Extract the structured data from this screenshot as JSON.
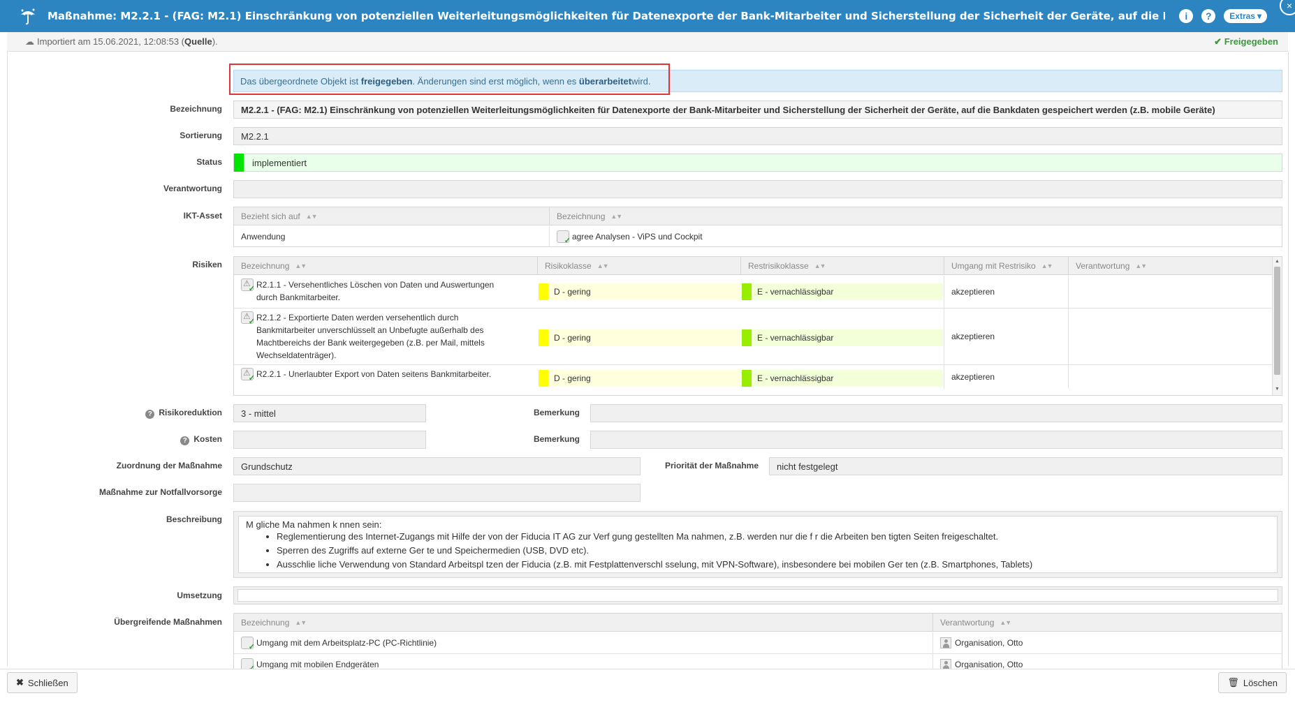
{
  "titlebar": {
    "title": "Maßnahme: M2.2.1 - (FAG: M2.1) Einschränkung von potenziellen Weiterleitungsmöglichkeiten für Datenexporte der Bank-Mitarbeiter und Sicherstellung der Sicherheit der Geräte, auf die Bankdaten gespeichert werden...",
    "info_icon": "i",
    "help_icon": "?",
    "extras_label": "Extras",
    "close_icon": "×"
  },
  "subbar": {
    "imported_prefix": "Importiert am 15.06.2021, 12:08:53 (",
    "source_link": "Quelle",
    "imported_suffix": ").",
    "status_label": "Freigegeben"
  },
  "info": {
    "part1": "Das übergeordnete Objekt ist ",
    "bold1": "freigegeben",
    "part2": ". Änderungen sind erst möglich, wenn es ",
    "bold2": "überarbeitet",
    "part3": " wird."
  },
  "labels": {
    "bezeichnung": "Bezeichnung",
    "sortierung": "Sortierung",
    "status": "Status",
    "verantwortung": "Verantwortung",
    "ikt_asset": "IKT-Asset",
    "risiken": "Risiken",
    "risikoreduktion": "Risikoreduktion",
    "kosten": "Kosten",
    "bemerkung": "Bemerkung",
    "zuordnung": "Zuordnung der Maßnahme",
    "prioritaet": "Priorität der Maßnahme",
    "notfall": "Maßnahme zur Notfallvorsorge",
    "beschreibung": "Beschreibung",
    "umsetzung": "Umsetzung",
    "uebergreifend": "Übergreifende Maßnahmen"
  },
  "fields": {
    "bezeichnung": "M2.2.1 - (FAG: M2.1) Einschränkung von potenziellen Weiterleitungsmöglichkeiten für Datenexporte der Bank-Mitarbeiter und Sicherstellung der Sicherheit der Geräte, auf die Bankdaten gespeichert werden (z.B. mobile Geräte)",
    "sortierung": "M2.2.1",
    "status": "implementiert",
    "verantwortung": "",
    "risikoreduktion": "3 - mittel",
    "bemerkung1": "",
    "kosten": "",
    "bemerkung2": "",
    "zuordnung": "Grundschutz",
    "prioritaet": "nicht festgelegt",
    "notfall": "",
    "umsetzung": ""
  },
  "colors": {
    "titlebar": "#2c85c1",
    "status_green": "#00e600",
    "status_bg": "#eaffea",
    "risk_yellow": "#ffff00",
    "risk_yellow_bg": "#ffffdd",
    "rest_green": "#99ee00",
    "rest_green_bg": "#f2ffd9",
    "highlight_red": "#e0343b"
  },
  "ikt_table": {
    "headers": [
      "Bezieht sich auf",
      "Bezeichnung"
    ],
    "rows": [
      {
        "bezieht": "Anwendung",
        "bezeichnung": "agree Analysen - ViPS und Cockpit"
      }
    ]
  },
  "risk_table": {
    "headers": [
      "Bezeichnung",
      "Risikoklasse",
      "Restrisikoklasse",
      "Umgang mit Restrisiko",
      "Verantwortung"
    ],
    "rows": [
      {
        "line1": "R2.1.1 - Versehentliches Löschen von Daten und Auswertungen",
        "line2": "durch Bankmitarbeiter.",
        "line3": "",
        "line4": "",
        "risikoklasse": "D - gering",
        "restrisiko": "E - vernachlässigbar",
        "umgang": "akzeptieren",
        "verantwortung": ""
      },
      {
        "line1": "R2.1.2 - Exportierte Daten werden versehentlich durch",
        "line2": "Bankmitarbeiter unverschlüsselt an Unbefugte außerhalb des",
        "line3": "Machtbereichs der Bank weitergegeben (z.B. per Mail, mittels",
        "line4": "Wechseldatenträger).",
        "risikoklasse": "D - gering",
        "restrisiko": "E - vernachlässigbar",
        "umgang": "akzeptieren",
        "verantwortung": ""
      },
      {
        "line1": "R2.2.1 - Unerlaubter Export von Daten seitens Bankmitarbeiter.",
        "line2": "",
        "line3": "",
        "line4": "",
        "risikoklasse": "D - gering",
        "restrisiko": "E - vernachlässigbar",
        "umgang": "akzeptieren",
        "verantwortung": ""
      }
    ]
  },
  "beschreibung": {
    "intro": "M gliche Ma  nahmen k  nnen sein:",
    "items": [
      "Reglementierung des Internet-Zugangs mit Hilfe der von der Fiducia IT AG zur Verf  gung gestellten Ma  nahmen, z.B. werden nur die f  r die Arbeiten ben  tigten Seiten freigeschaltet.",
      "Sperren des Zugriffs auf externe Ger  te und Speichermedien (USB, DVD etc).",
      "Ausschlie  liche Verwendung von Standard Arbeitspl  tzen der Fiducia (z.B. mit Festplattenverschl  sselung, mit VPN-Software), insbesondere bei mobilen Ger  ten (z.B. Smartphones, Tablets)"
    ]
  },
  "uebergreifend_table": {
    "headers": [
      "Bezeichnung",
      "Verantwortung"
    ],
    "rows": [
      {
        "bezeichnung": "Umgang mit dem Arbeitsplatz-PC (PC-Richtlinie)",
        "verantwortung": "Organisation, Otto"
      },
      {
        "bezeichnung": "Umgang mit mobilen Endgeräten",
        "verantwortung": "Organisation, Otto"
      }
    ]
  },
  "footer": {
    "close_label": "Schließen",
    "delete_label": "Löschen"
  }
}
